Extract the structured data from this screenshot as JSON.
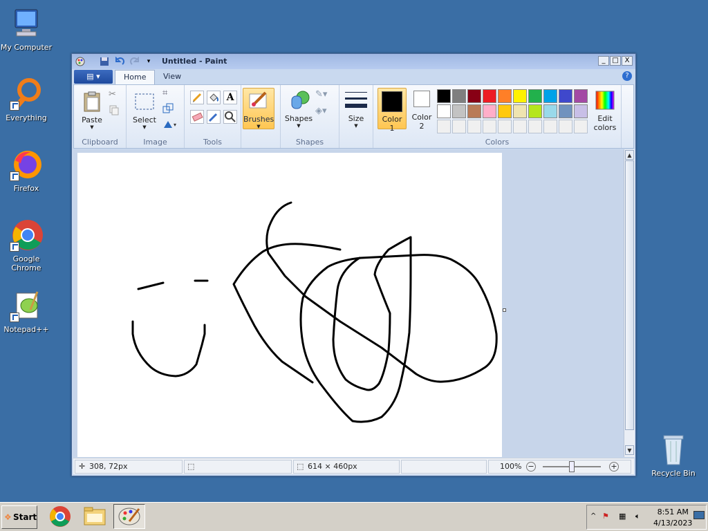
{
  "desktop": {
    "icons": [
      {
        "label": "My Computer"
      },
      {
        "label": "Everything"
      },
      {
        "label": "Firefox"
      },
      {
        "label": "Google Chrome"
      },
      {
        "label": "Notepad++"
      },
      {
        "label": "Recycle Bin"
      }
    ]
  },
  "window": {
    "title": "Untitled - Paint",
    "controls": {
      "minimize": "_",
      "maximize": "□",
      "close": "X"
    },
    "tabs": [
      {
        "label": "Home"
      },
      {
        "label": "View"
      }
    ],
    "help": "?"
  },
  "ribbon": {
    "clipboard": {
      "paste": "Paste",
      "group": "Clipboard"
    },
    "image": {
      "select": "Select",
      "group": "Image"
    },
    "tools": {
      "group": "Tools",
      "text_tool": "A"
    },
    "brushes": "Brushes",
    "shapes": {
      "label": "Shapes",
      "group": "Shapes"
    },
    "size": "Size",
    "colors": {
      "color1_label": "Color",
      "color1_num": "1",
      "color2_label": "Color",
      "color2_num": "2",
      "edit_colors_1": "Edit",
      "edit_colors_2": "colors",
      "group": "Colors",
      "color1": "#000000",
      "color2": "#ffffff",
      "row1": [
        "#000000",
        "#7f7f7f",
        "#880015",
        "#ed1c24",
        "#ff7f27",
        "#fff200",
        "#22b14c",
        "#00a2e8",
        "#3f48cc",
        "#a349a4"
      ],
      "row2": [
        "#ffffff",
        "#c3c3c3",
        "#b97a57",
        "#ffaec9",
        "#ffc90e",
        "#efe4b0",
        "#b5e61d",
        "#99d9ea",
        "#7092be",
        "#c8bfe7"
      ],
      "row3": [
        "#f0f0f0",
        "#f0f0f0",
        "#f0f0f0",
        "#f0f0f0",
        "#f0f0f0",
        "#f0f0f0",
        "#f0f0f0",
        "#f0f0f0",
        "#f0f0f0",
        "#f0f0f0"
      ]
    }
  },
  "status": {
    "cursor_pos": "308, 72px",
    "selection": "",
    "canvas_size": "614 × 460px",
    "zoom": "100%",
    "zoom_minus": "−",
    "zoom_plus": "+"
  },
  "taskbar": {
    "start": "Start",
    "time": "8:51 AM",
    "date": "4/13/2023"
  }
}
